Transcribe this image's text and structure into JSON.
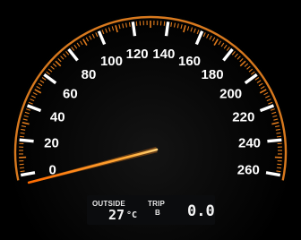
{
  "speedometer": {
    "labels": [
      "0",
      "20",
      "40",
      "60",
      "80",
      "100",
      "120",
      "140",
      "160",
      "180",
      "200",
      "220",
      "240",
      "260"
    ],
    "needle_value": 0,
    "colors": {
      "background": "#000000",
      "labels": "#ffffff",
      "major_ticks": "#ffffff",
      "minor_ticks": "#e07a1c",
      "outer_ring": "#d8791e",
      "needle": "#ff8a1a"
    }
  },
  "display": {
    "outside_label": "OUTSIDE",
    "outside_temp": "27",
    "outside_unit": "°C",
    "trip_label": "TRIP",
    "trip_id": "B",
    "trip_value": "0.0"
  }
}
